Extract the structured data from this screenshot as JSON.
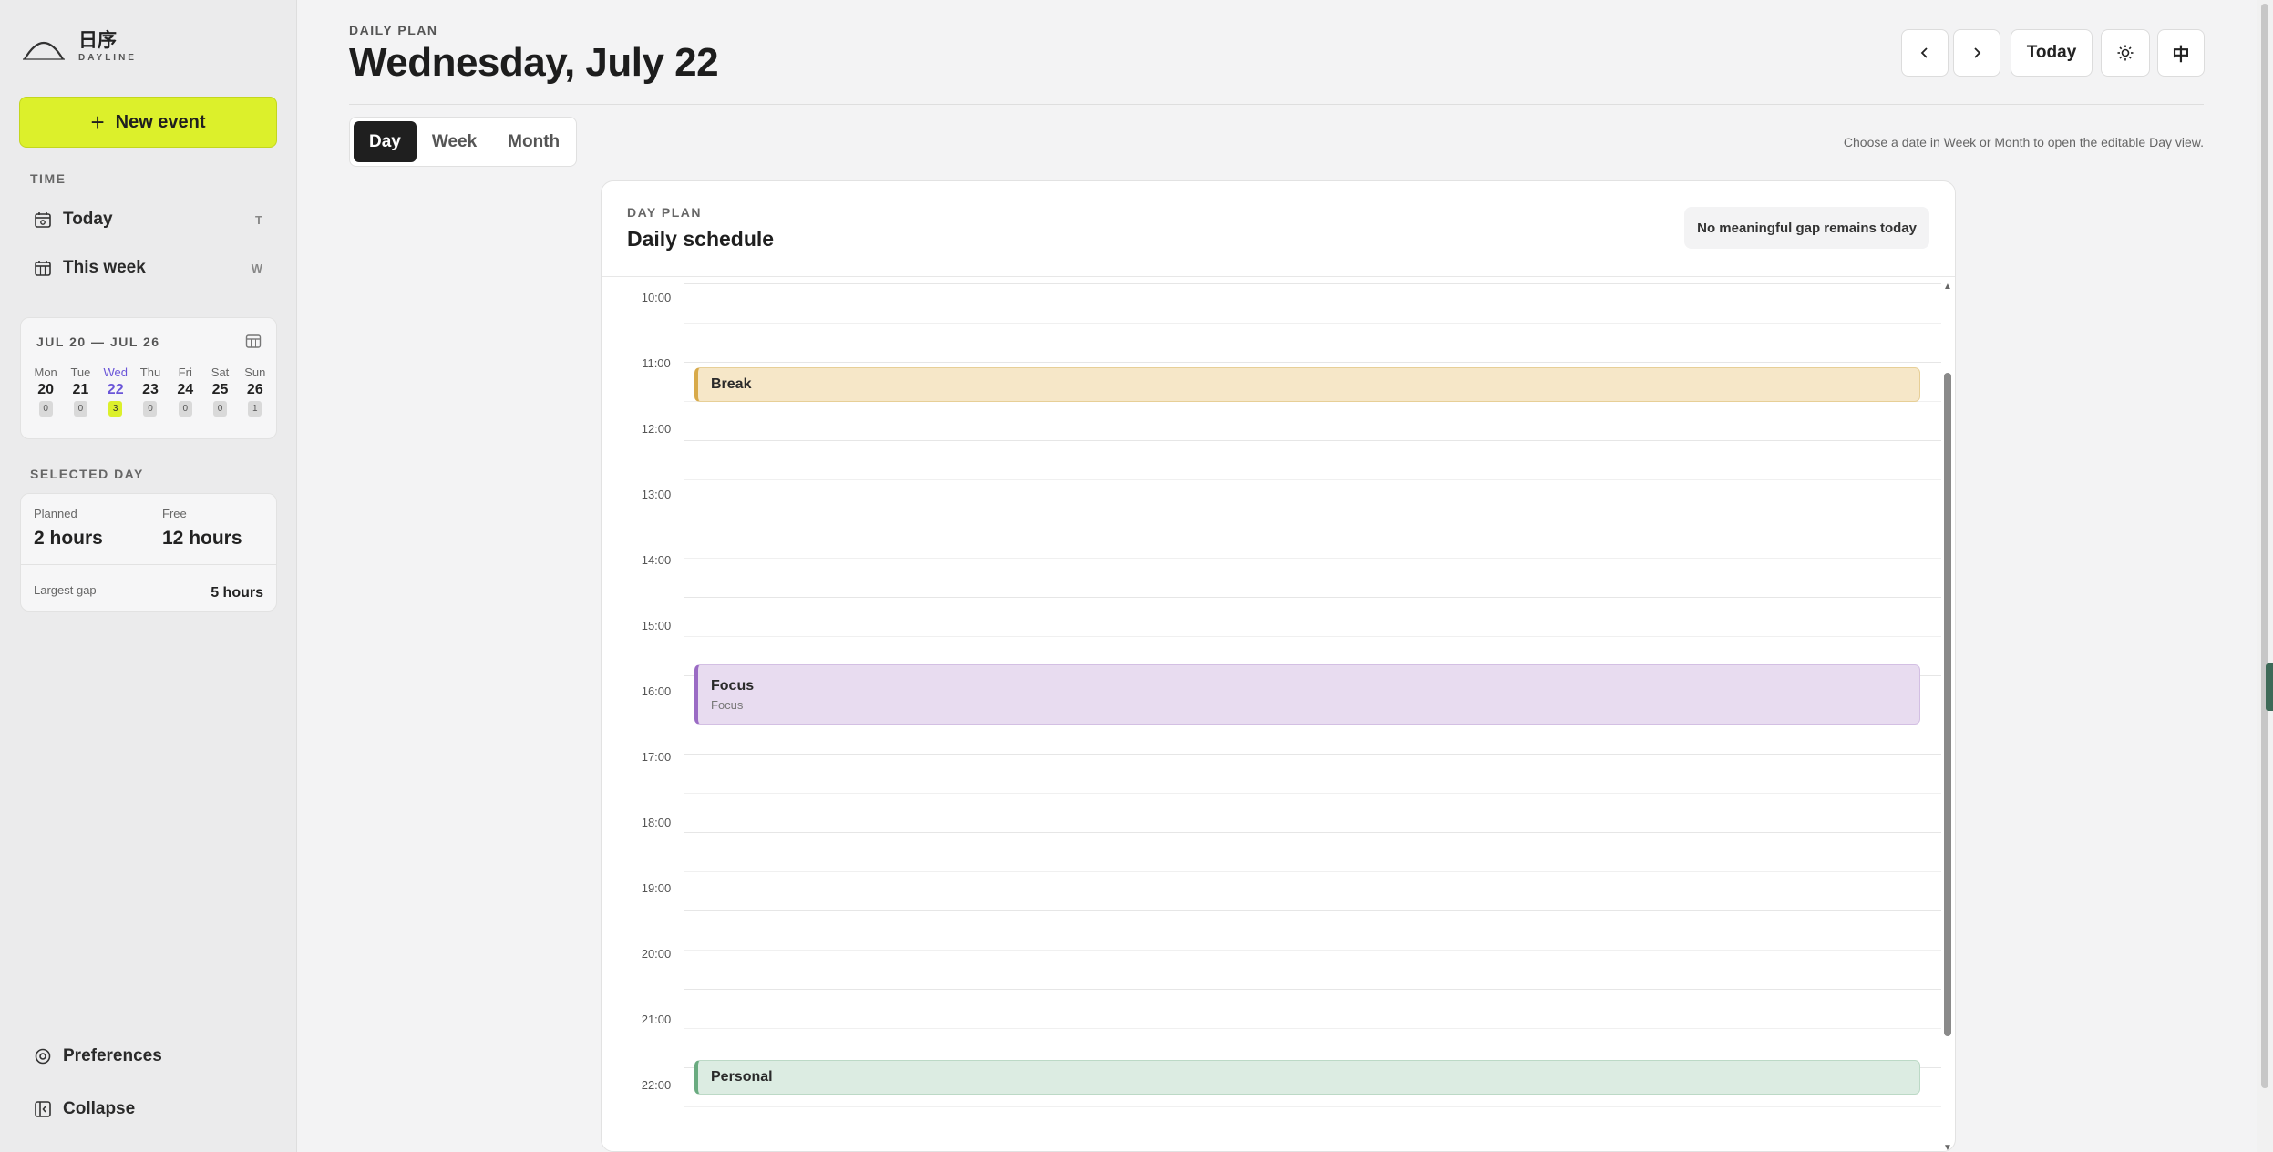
{
  "app": {
    "name": "日序",
    "subtitle": "DAYLINE"
  },
  "sidebar": {
    "new_event_label": "New event",
    "time_section_label": "TIME",
    "nav": [
      {
        "label": "Today",
        "shortcut": "T",
        "icon": "calendar-today-icon"
      },
      {
        "label": "This week",
        "shortcut": "W",
        "icon": "calendar-week-icon"
      }
    ],
    "mini_week": {
      "range": "JUL 20 — JUL 26",
      "days": [
        {
          "name": "Mon",
          "date": "20",
          "count": "0"
        },
        {
          "name": "Tue",
          "date": "21",
          "count": "0"
        },
        {
          "name": "Wed",
          "date": "22",
          "count": "3",
          "active": true
        },
        {
          "name": "Thu",
          "date": "23",
          "count": "0"
        },
        {
          "name": "Fri",
          "date": "24",
          "count": "0"
        },
        {
          "name": "Sat",
          "date": "25",
          "count": "0"
        },
        {
          "name": "Sun",
          "date": "26",
          "count": "1"
        }
      ]
    },
    "selected_day_label": "SELECTED DAY",
    "stats": {
      "planned_label": "Planned",
      "planned_value": "2 hours",
      "free_label": "Free",
      "free_value": "12 hours",
      "largest_gap_label": "Largest gap",
      "largest_gap_value": "5 hours"
    },
    "preferences_label": "Preferences",
    "collapse_label": "Collapse"
  },
  "header": {
    "eyebrow": "DAILY PLAN",
    "title": "Wednesday, July 22",
    "today_button": "Today",
    "lang_button": "中"
  },
  "views": {
    "tabs": [
      "Day",
      "Week",
      "Month"
    ],
    "active": "Day",
    "hint": "Choose a date in Week or Month to open the editable Day view."
  },
  "schedule": {
    "eyebrow": "DAY PLAN",
    "title": "Daily schedule",
    "badge": "No meaningful gap remains today",
    "hours": [
      "10:00",
      "11:00",
      "12:00",
      "13:00",
      "14:00",
      "15:00",
      "16:00",
      "17:00",
      "18:00",
      "19:00",
      "20:00",
      "21:00",
      "22:00"
    ],
    "events": [
      {
        "title": "Break",
        "subtitle": "",
        "color": "#f6e7c8"
      },
      {
        "title": "Focus",
        "subtitle": "Focus",
        "color": "#e8dcf0"
      },
      {
        "title": "Personal",
        "subtitle": "",
        "color": "#dcece2"
      }
    ]
  },
  "colors": {
    "accent": "#dcf02b",
    "active_day": "#6a55d8",
    "dark_tab": "#1f1f1f"
  }
}
